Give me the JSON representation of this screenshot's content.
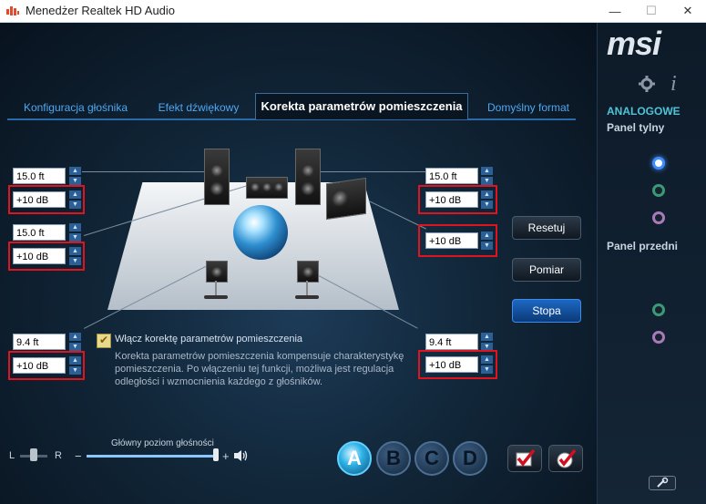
{
  "window": {
    "title": "Menedżer Realtek HD Audio",
    "minimize": "—",
    "maximize": "☐",
    "close": "✕"
  },
  "tabs": [
    {
      "label": "Konfiguracja głośnika"
    },
    {
      "label": "Efekt dźwiękowy"
    },
    {
      "label": "Korekta parametrów pomieszczenia"
    },
    {
      "label": "Domyślny format"
    }
  ],
  "speakers": {
    "front_left": {
      "distance": "15.0 ft",
      "gain": "+10 dB"
    },
    "center": {
      "gain": "+10 dB"
    },
    "front_right": {
      "distance": "15.0 ft",
      "gain": "+10 dB"
    },
    "subwoofer": {
      "gain": "+10 dB"
    },
    "rear_left": {
      "distance": "9.4 ft",
      "gain": "+10 dB"
    },
    "rear_right": {
      "distance": "9.4 ft",
      "gain": "+10 dB"
    }
  },
  "correction": {
    "checkbox_label": "Włącz korektę parametrów pomieszczenia",
    "checked": true,
    "description": "Korekta parametrów pomieszczenia kompensuje charakterystykę pomieszczenia. Po włączeniu tej funkcji, możliwa jest regulacja odległości i wzmocnienia każdego z głośników."
  },
  "buttons": {
    "reset": "Resetuj",
    "measure": "Pomiar",
    "stop": "Stopa"
  },
  "volume": {
    "title": "Główny poziom głośności",
    "left": "L",
    "right": "R",
    "minus": "−",
    "plus": "+",
    "balance": 0.5,
    "level": 1.0
  },
  "presets": [
    "A",
    "B",
    "C",
    "D"
  ],
  "side": {
    "brand": "msi",
    "section": "ANALOGOWE",
    "rear_panel": "Panel tylny",
    "front_panel": "Panel przedni",
    "info": "i",
    "settings_icon": "gear-icon",
    "wrench_icon": "wrench-icon"
  },
  "colors": {
    "accent_blue": "#4fa7f0",
    "highlight_red": "#e0141e",
    "jack_blue": "#3f8cff",
    "jack_green": "#3a9a78",
    "jack_pink": "#a77ab8"
  }
}
